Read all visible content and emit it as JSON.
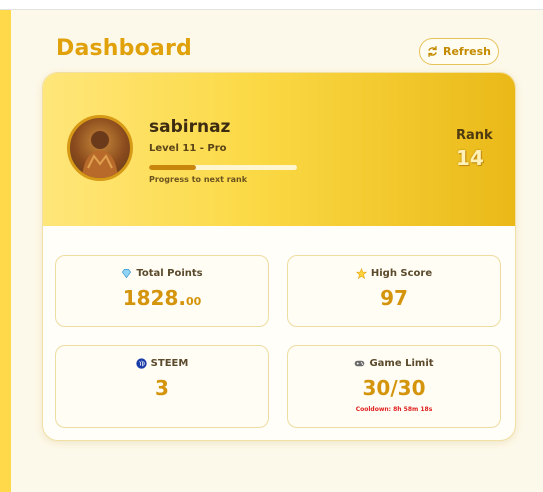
{
  "header": {
    "title": "Dashboard",
    "refresh_label": "Refresh"
  },
  "profile": {
    "username": "sabirnaz",
    "level": "Level 11 - Pro",
    "progress_fraction": 0.32,
    "progress_label": "Progress to next rank",
    "rank_label": "Rank",
    "rank_value": "14"
  },
  "stats": {
    "total_points": {
      "icon": "diamond-icon",
      "label": "Total Points",
      "value_main": "1828.",
      "value_decimals": "00"
    },
    "high_score": {
      "icon": "star-icon",
      "label": "High Score",
      "value": "97"
    },
    "steem": {
      "icon": "steem-logo-icon",
      "label": "STEEM",
      "value": "3"
    },
    "game_limit": {
      "icon": "gamepad-icon",
      "label": "Game Limit",
      "value": "30/30",
      "cooldown": "Cooldown: 8h 58m 18s"
    }
  },
  "colors": {
    "accent": "#e0a10a",
    "value": "#d4940c",
    "cooldown": "#e02020",
    "sidebar": "#ffd94a"
  }
}
